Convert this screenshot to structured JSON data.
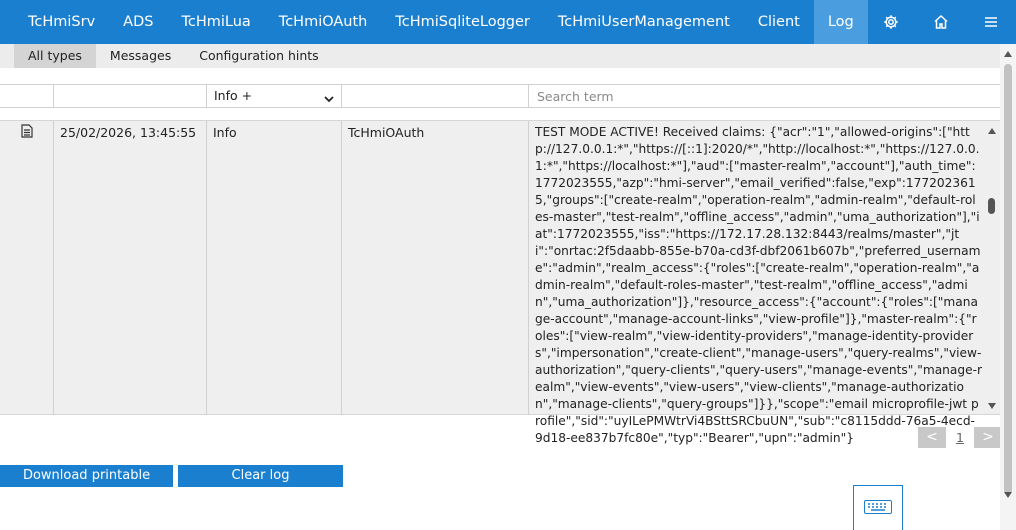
{
  "nav": {
    "items": [
      {
        "label": "TcHmiSrv"
      },
      {
        "label": "ADS"
      },
      {
        "label": "TcHmiLua"
      },
      {
        "label": "TcHmiOAuth"
      },
      {
        "label": "TcHmiSqliteLogger"
      },
      {
        "label": "TcHmiUserManagement"
      },
      {
        "label": "Client"
      },
      {
        "label": "Log",
        "active": true
      }
    ],
    "icons": [
      "gear-icon",
      "home-icon",
      "menu-icon"
    ]
  },
  "subtabs": [
    {
      "label": "All types",
      "active": true
    },
    {
      "label": "Messages"
    },
    {
      "label": "Configuration hints"
    }
  ],
  "filter": {
    "type_selected": "Info +",
    "search_placeholder": "Search term"
  },
  "log": {
    "rows": [
      {
        "icon": "document-icon",
        "timestamp": "25/02/2026, 13:45:55",
        "level": "Info",
        "source": "TcHmiOAuth",
        "message": "TEST MODE ACTIVE! Received claims: {\"acr\":\"1\",\"allowed-origins\":[\"http://127.0.0.1:*\",\"https://[::1]:2020/*\",\"http://localhost:*\",\"https://127.0.0.1:*\",\"https://localhost:*\"],\"aud\":[\"master-realm\",\"account\"],\"auth_time\":1772023555,\"azp\":\"hmi-server\",\"email_verified\":false,\"exp\":1772023615,\"groups\":[\"create-realm\",\"operation-realm\",\"admin-realm\",\"default-roles-master\",\"test-realm\",\"offline_access\",\"admin\",\"uma_authorization\"],\"iat\":1772023555,\"iss\":\"https://172.17.28.132:8443/realms/master\",\"jti\":\"onrtac:2f5daabb-855e-b70a-cd3f-dbf2061b607b\",\"preferred_username\":\"admin\",\"realm_access\":{\"roles\":[\"create-realm\",\"operation-realm\",\"admin-realm\",\"default-roles-master\",\"test-realm\",\"offline_access\",\"admin\",\"uma_authorization\"]},\"resource_access\":{\"account\":{\"roles\":[\"manage-account\",\"manage-account-links\",\"view-profile\"]},\"master-realm\":{\"roles\":[\"view-realm\",\"view-identity-providers\",\"manage-identity-providers\",\"impersonation\",\"create-client\",\"manage-users\",\"query-realms\",\"view-authorization\",\"query-clients\",\"query-users\",\"manage-events\",\"manage-realm\",\"view-events\",\"view-users\",\"view-clients\",\"manage-authorization\",\"manage-clients\",\"query-groups\"]}},\"scope\":\"email microprofile-jwt profile\",\"sid\":\"uyILePMWtrVi4BSttSRCbuUN\",\"sub\":\"c8115ddd-76a5-4ecd-9d18-ee837b7fc80e\",\"typ\":\"Bearer\",\"upn\":\"admin\"}"
      }
    ]
  },
  "pager": {
    "prev": "<",
    "page": "1",
    "next": ">"
  },
  "buttons": {
    "download": "Download printable version",
    "clear": "Clear log"
  },
  "keyboard_icon": "keyboard-icon"
}
